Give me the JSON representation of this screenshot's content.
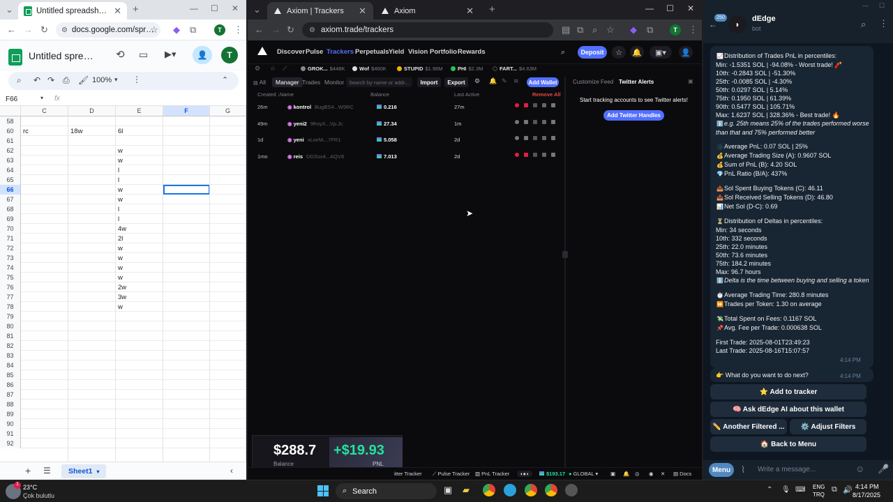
{
  "sheets_window": {
    "tab_title": "Untitled spreadsheet - Google S",
    "url": "docs.google.com/spre...",
    "doc_title": "Untitled spreads",
    "zoom": "100%",
    "name_box": "F66",
    "fx": "fx",
    "columns": [
      "C",
      "D",
      "E",
      "F",
      "G"
    ],
    "rows": [
      {
        "n": "58",
        "c": "",
        "d": "",
        "e": ""
      },
      {
        "n": "60",
        "c": "rc",
        "d": "18w",
        "e": "6l"
      },
      {
        "n": "61",
        "c": "",
        "d": "",
        "e": ""
      },
      {
        "n": "62",
        "c": "",
        "d": "",
        "e": "w"
      },
      {
        "n": "63",
        "c": "",
        "d": "",
        "e": "w"
      },
      {
        "n": "64",
        "c": "",
        "d": "",
        "e": "l"
      },
      {
        "n": "65",
        "c": "",
        "d": "",
        "e": "l"
      },
      {
        "n": "66",
        "c": "",
        "d": "",
        "e": "w"
      },
      {
        "n": "67",
        "c": "",
        "d": "",
        "e": "w"
      },
      {
        "n": "68",
        "c": "",
        "d": "",
        "e": "l"
      },
      {
        "n": "69",
        "c": "",
        "d": "",
        "e": "l"
      },
      {
        "n": "70",
        "c": "",
        "d": "",
        "e": "4w"
      },
      {
        "n": "71",
        "c": "",
        "d": "",
        "e": "2l"
      },
      {
        "n": "72",
        "c": "",
        "d": "",
        "e": "w"
      },
      {
        "n": "73",
        "c": "",
        "d": "",
        "e": "w"
      },
      {
        "n": "74",
        "c": "",
        "d": "",
        "e": "w"
      },
      {
        "n": "75",
        "c": "",
        "d": "",
        "e": "w"
      },
      {
        "n": "76",
        "c": "",
        "d": "",
        "e": "2w"
      },
      {
        "n": "77",
        "c": "",
        "d": "",
        "e": "3w"
      },
      {
        "n": "78",
        "c": "",
        "d": "",
        "e": "w"
      },
      {
        "n": "79",
        "c": "",
        "d": "",
        "e": ""
      },
      {
        "n": "80",
        "c": "",
        "d": "",
        "e": ""
      },
      {
        "n": "81",
        "c": "",
        "d": "",
        "e": ""
      },
      {
        "n": "82",
        "c": "",
        "d": "",
        "e": ""
      },
      {
        "n": "83",
        "c": "",
        "d": "",
        "e": ""
      },
      {
        "n": "84",
        "c": "",
        "d": "",
        "e": ""
      },
      {
        "n": "85",
        "c": "",
        "d": "",
        "e": ""
      },
      {
        "n": "86",
        "c": "",
        "d": "",
        "e": ""
      },
      {
        "n": "87",
        "c": "",
        "d": "",
        "e": ""
      },
      {
        "n": "88",
        "c": "",
        "d": "",
        "e": ""
      },
      {
        "n": "89",
        "c": "",
        "d": "",
        "e": ""
      },
      {
        "n": "90",
        "c": "",
        "d": "",
        "e": ""
      },
      {
        "n": "91",
        "c": "",
        "d": "",
        "e": ""
      },
      {
        "n": "92",
        "c": "",
        "d": "",
        "e": ""
      }
    ],
    "sheet_tab": "Sheet1",
    "avatar_letter": "T"
  },
  "axiom_window": {
    "tab_active": "Axiom | Trackers",
    "tab_other": "Axiom",
    "url": "axiom.trade/trackers",
    "nav": [
      "Discover",
      "Pulse",
      "Trackers",
      "Perpetuals",
      "Yield",
      "Vision",
      "Portfolio",
      "Rewards"
    ],
    "deposit": "Deposit",
    "ticker": [
      {
        "sym": "GROK...",
        "val": "$448K",
        "color": "#888888"
      },
      {
        "sym": "Wof",
        "val": "$460K",
        "color": "#dddddd"
      },
      {
        "sym": "STUPID",
        "val": "$1.96M",
        "color": "#f0b400"
      },
      {
        "sym": "PHI",
        "val": "$2.3M",
        "color": "#22c55e"
      },
      {
        "sym": "FART...",
        "val": "$4.63M",
        "color": "#111111"
      }
    ],
    "subtabs": {
      "all": "All",
      "manager": "Manager",
      "trades": "Trades",
      "monitor": "Monitor"
    },
    "search_placeholder": "Search by name or addr...",
    "import": "Import",
    "export": "Export",
    "add_wallet": "Add Wallet",
    "col_headers": {
      "created": "Created",
      "name": "Name",
      "balance": "Balance",
      "last_active": "Last Active",
      "remove_all": "Remove All"
    },
    "wallets": [
      {
        "age": "26m",
        "name": "kontrol",
        "addr": "BugBS4...W9RC",
        "balance": "0.216",
        "last": "27m",
        "c1": "#e11d48",
        "c2": "#e11d48"
      },
      {
        "age": "49m",
        "name": "yeni2",
        "addr": "9froyX...Vp.Jc",
        "balance": "27.34",
        "last": "1m",
        "c1": "#777777",
        "c2": "#777777"
      },
      {
        "age": "1d",
        "name": "yeni",
        "addr": "xLwrfA...7FR1",
        "balance": "5.058",
        "last": "2d",
        "c1": "#777777",
        "c2": "#777777"
      },
      {
        "age": "1mo",
        "name": "reis",
        "addr": "DGSsx4...AQV8",
        "balance": "7.013",
        "last": "2d",
        "c1": "#e11d48",
        "c2": "#e11d48"
      }
    ],
    "right_tabs": {
      "customize": "Customize Feed",
      "twitter": "Twitter Alerts"
    },
    "twitter_msg": "Start tracking accounts to see Twitter alerts!",
    "add_twitter": "Add Twitter Handles",
    "pnl_card": {
      "balance": "$288.7",
      "balance_label": "Balance",
      "pnl": "+$19.93",
      "pnl_label": "PNL"
    },
    "statusbar": {
      "twitter_tracker": "itter Tracker",
      "pulse_tracker": "Pulse Tracker",
      "pnl_tracker": "PnL Tracker",
      "sol_price": "$193.17",
      "region": "GLOBAL",
      "docs": "Docs"
    }
  },
  "telegram": {
    "bot_name": "dEdge",
    "bot_sub": "bot",
    "unread_badge": "250",
    "message_lines": [
      {
        "ic": "📈",
        "t": "Distribution of Trades PnL in percentiles:"
      },
      {
        "ic": "",
        "t": "Min: -1.5351 SOL | -94.08% - Worst trade! 🧨"
      },
      {
        "ic": "",
        "t": "10th: -0.2843 SOL | -51.30%"
      },
      {
        "ic": "",
        "t": "25th: -0.0085 SOL | -4.30%"
      },
      {
        "ic": "",
        "t": "50th: 0.0297 SOL | 5.14%"
      },
      {
        "ic": "",
        "t": "75th: 0.1950 SOL | 61.39%"
      },
      {
        "ic": "",
        "t": "90th: 0.5477 SOL | 105.71%"
      },
      {
        "ic": "",
        "t": "Max: 1.6237 SOL | 328.36% - Best trade! 🔥"
      },
      {
        "ic": "ℹ️",
        "t": "e.g. 25th means 25% of the trades performed worse"
      },
      {
        "ic": "",
        "t": "than that and 75% performed better"
      },
      {
        "ic": "",
        "t": ""
      },
      {
        "ic": "🌑",
        "t": "Average PnL: 0.07 SOL | 25%"
      },
      {
        "ic": "💰",
        "t": "Average Trading Size (A): 0.9607 SOL"
      },
      {
        "ic": "💰",
        "t": "Sum of PnL (B): 4.20 SOL"
      },
      {
        "ic": "💎",
        "t": "PnL Ratio (B/A): 437%"
      },
      {
        "ic": "",
        "t": ""
      },
      {
        "ic": "📤",
        "t": "Sol Spent Buying Tokens (C): 46.11"
      },
      {
        "ic": "📥",
        "t": "Sol Received Selling Tokens (D): 46.80"
      },
      {
        "ic": "📊",
        "t": "Net Sol (D-C): 0.69"
      },
      {
        "ic": "",
        "t": ""
      },
      {
        "ic": "⏳",
        "t": "Distribution of Deltas in percentiles:"
      },
      {
        "ic": "",
        "t": "Min: 34 seconds"
      },
      {
        "ic": "",
        "t": "10th: 332 seconds"
      },
      {
        "ic": "",
        "t": "25th: 22.0 minutes"
      },
      {
        "ic": "",
        "t": "50th: 73.6 minutes"
      },
      {
        "ic": "",
        "t": "75th: 184.2 minutes"
      },
      {
        "ic": "",
        "t": "Max: 96.7 hours"
      },
      {
        "ic": "ℹ️",
        "t": "Delta is the time between buying and selling a token"
      },
      {
        "ic": "",
        "t": ""
      },
      {
        "ic": "⏱️",
        "t": "Average Trading Time: 280.8 minutes"
      },
      {
        "ic": "⏩",
        "t": "Trades per Token: 1.30 on average"
      },
      {
        "ic": "",
        "t": ""
      },
      {
        "ic": "💸",
        "t": "Total Spent on Fees: 0.1167 SOL"
      },
      {
        "ic": "📌",
        "t": "Avg. Fee per Trade: 0.000638 SOL"
      },
      {
        "ic": "",
        "t": ""
      },
      {
        "ic": "",
        "t": "First Trade: 2025-08-01T23:49:23"
      },
      {
        "ic": "",
        "t": "Last Trade: 2025-08-16T15:07:57"
      }
    ],
    "msg_time": "4:14 PM",
    "question": "👉 What do you want to do next?",
    "question_time": "4:14 PM",
    "kbd": {
      "add_tracker": "⭐ Add to tracker",
      "ask_ai": "🧠 Ask dEdge AI about this wallet",
      "another": "✏️ Another Filtered ...",
      "adjust": "⚙️ Adjust Filters",
      "back": "🏠 Back to Menu"
    },
    "menu_btn": "Menu",
    "compose_placeholder": "Write a message..."
  },
  "taskbar": {
    "weather_temp": "23°C",
    "weather_desc": "Çok bulutlu",
    "search": "Search",
    "lang1": "ENG",
    "lang2": "TRQ",
    "time": "4:14 PM",
    "date": "8/17/2025"
  }
}
